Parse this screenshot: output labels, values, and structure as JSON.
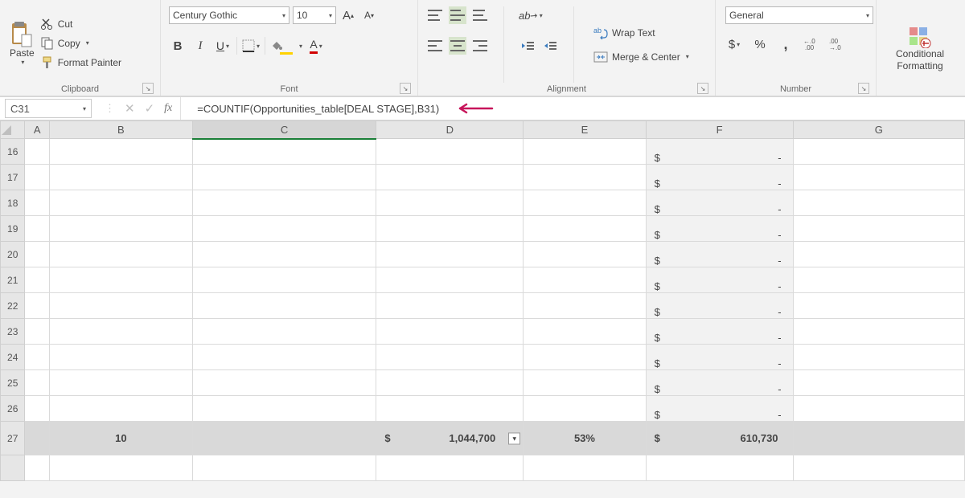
{
  "ribbon": {
    "clipboard": {
      "paste_label": "Paste",
      "cut": "Cut",
      "copy": "Copy",
      "format_painter": "Format Painter",
      "group_label": "Clipboard"
    },
    "font": {
      "font_name": "Century Gothic",
      "font_size": "10",
      "bold": "B",
      "italic": "I",
      "underline": "U",
      "font_color_letter": "A",
      "bigger_a": "A",
      "smaller_a": "A",
      "group_label": "Font"
    },
    "alignment": {
      "wrap_text": "Wrap Text",
      "merge_center": "Merge & Center",
      "group_label": "Alignment"
    },
    "number": {
      "format": "General",
      "currency": "$",
      "percent": "%",
      "comma": ",",
      "inc_dec": ".0",
      "group_label": "Number"
    },
    "styles": {
      "conditional_formatting_l1": "Conditional",
      "conditional_formatting_l2": "Formatting"
    }
  },
  "formula_bar": {
    "cell_ref": "C31",
    "formula": "=COUNTIF(Opportunities_table[DEAL STAGE],B31)"
  },
  "columns": [
    "A",
    "B",
    "C",
    "D",
    "E",
    "F",
    "G"
  ],
  "rows": [
    "16",
    "17",
    "18",
    "19",
    "20",
    "21",
    "22",
    "23",
    "24",
    "25",
    "26",
    "27"
  ],
  "totals": {
    "b": "10",
    "d": "1,044,700",
    "e": "53%",
    "f": "610,730"
  },
  "dollar": "$",
  "dash": "-"
}
